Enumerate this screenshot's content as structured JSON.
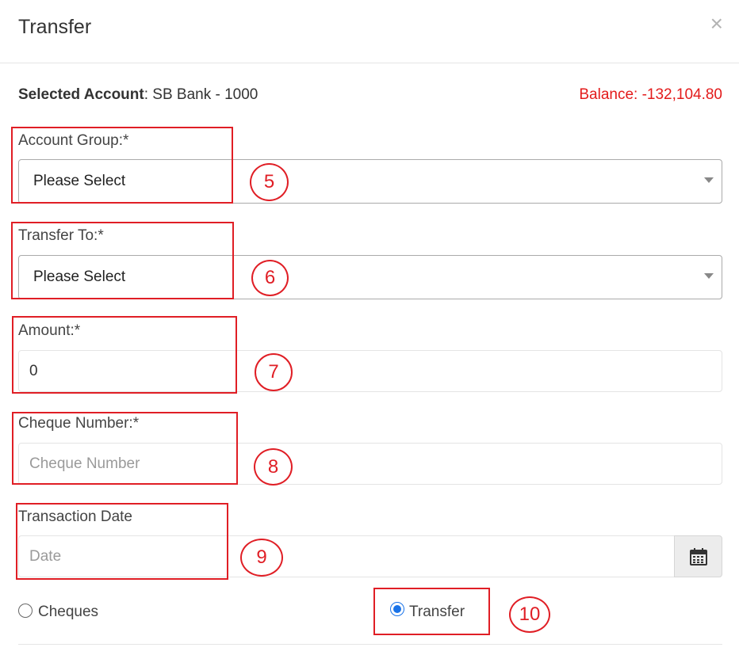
{
  "modal": {
    "title": "Transfer",
    "close_symbol": "×"
  },
  "selected_account": {
    "label": "Selected Account",
    "value": ": SB Bank - 1000"
  },
  "balance": "Balance: -132,104.80",
  "fields": {
    "account_group": {
      "label": "Account Group:*",
      "value": "Please Select"
    },
    "transfer_to": {
      "label": "Transfer To:*",
      "value": "Please Select"
    },
    "amount": {
      "label": "Amount:*",
      "value": "0"
    },
    "cheque_number": {
      "label": "Cheque Number:*",
      "placeholder": "Cheque Number"
    },
    "transaction_date": {
      "label": "Transaction Date",
      "placeholder": "Date"
    }
  },
  "payment_mode": {
    "options": [
      {
        "label": "Cheques",
        "checked": false
      },
      {
        "label": "Transfer",
        "checked": true
      }
    ]
  },
  "annotations": [
    "5",
    "6",
    "7",
    "8",
    "9",
    "10"
  ],
  "colors": {
    "annotation": "#e01e25",
    "balance": "#e31b1b",
    "radio_checked": "#1a73e8"
  },
  "icons": {
    "close": "close-icon",
    "calendar": "calendar-icon",
    "dropdown": "caret-down-icon"
  }
}
